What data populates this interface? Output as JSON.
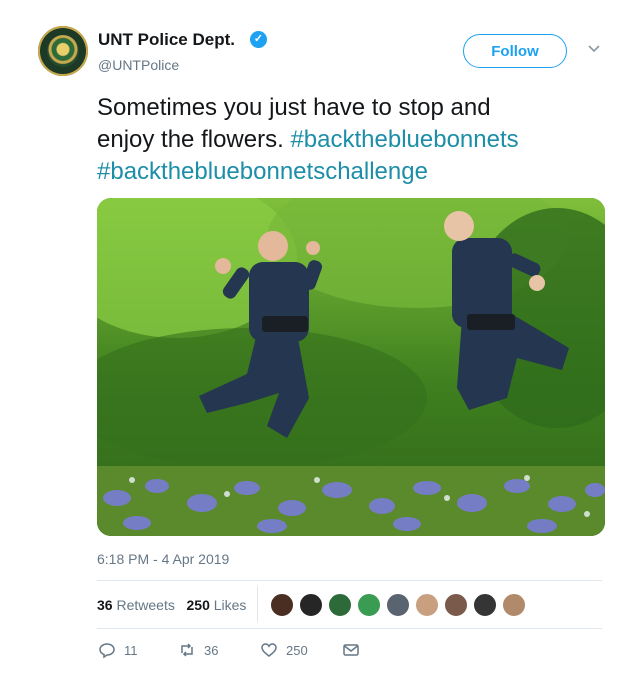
{
  "header": {
    "name": "UNT Police Dept.",
    "handle": "@UNTPolice",
    "follow_label": "Follow",
    "verified_icon": "verified-badge-icon"
  },
  "tweet": {
    "text_line1": "Sometimes you just have to stop and",
    "text_line2_plain": "enjoy the flowers. ",
    "hashtag1": "#backthebluebonnets",
    "hashtag2": "#backthebluebonnetschallenge"
  },
  "photo": {
    "description_icon": "photo-two-officers-jumping-in-bluebonnets"
  },
  "meta": {
    "timestamp": "6:18 PM - 4 Apr 2019"
  },
  "stats": {
    "retweets_count": "36",
    "retweets_label": "Retweets",
    "likes_count": "250",
    "likes_label": "Likes"
  },
  "actions": {
    "reply_count": "11",
    "retweet_count": "36",
    "like_count": "250"
  },
  "colors": {
    "accent": "#1da1f2",
    "hashtag": "#1d8ea8",
    "secondary_text": "#657786",
    "divider": "#e1e8ed"
  }
}
